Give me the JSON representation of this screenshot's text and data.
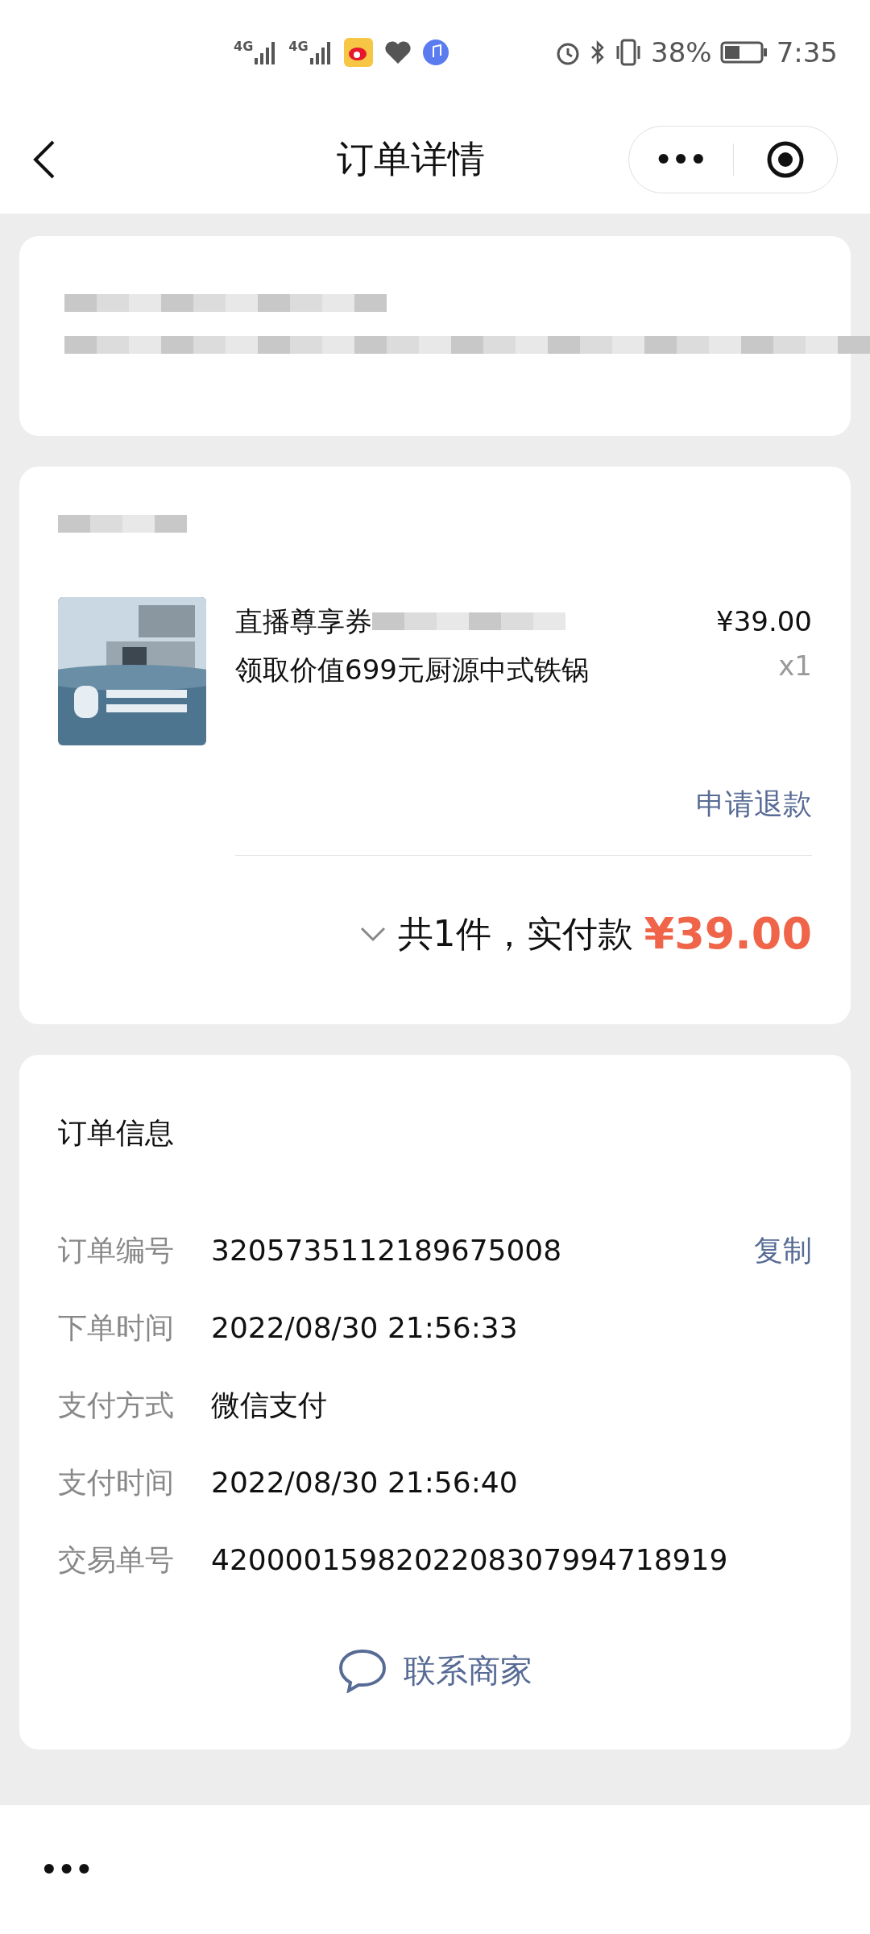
{
  "status_bar": {
    "battery_text": "38%",
    "time": "7:35",
    "network_labels": [
      "4G",
      "4G"
    ]
  },
  "nav": {
    "title": "订单详情",
    "menu_glyph": "•••"
  },
  "product": {
    "title_start": "直播尊享券",
    "title_line2": "领取价值699元厨源中式铁锅",
    "price": "¥39.00",
    "quantity": "x1",
    "refund": "申请退款",
    "summary": "共1件，实付款",
    "total": "¥39.00"
  },
  "order_info": {
    "title": "订单信息",
    "rows": [
      {
        "label": "订单编号",
        "value": "3205735112189675008",
        "action": "复制"
      },
      {
        "label": "下单时间",
        "value": "2022/08/30 21:56:33"
      },
      {
        "label": "支付方式",
        "value": "微信支付"
      },
      {
        "label": "支付时间",
        "value": "2022/08/30 21:56:40"
      },
      {
        "label": "交易单号",
        "value": "4200001598202208307994718919"
      }
    ],
    "contact": "联系商家"
  },
  "bottom_bar": {
    "menu_glyph": "•••"
  }
}
